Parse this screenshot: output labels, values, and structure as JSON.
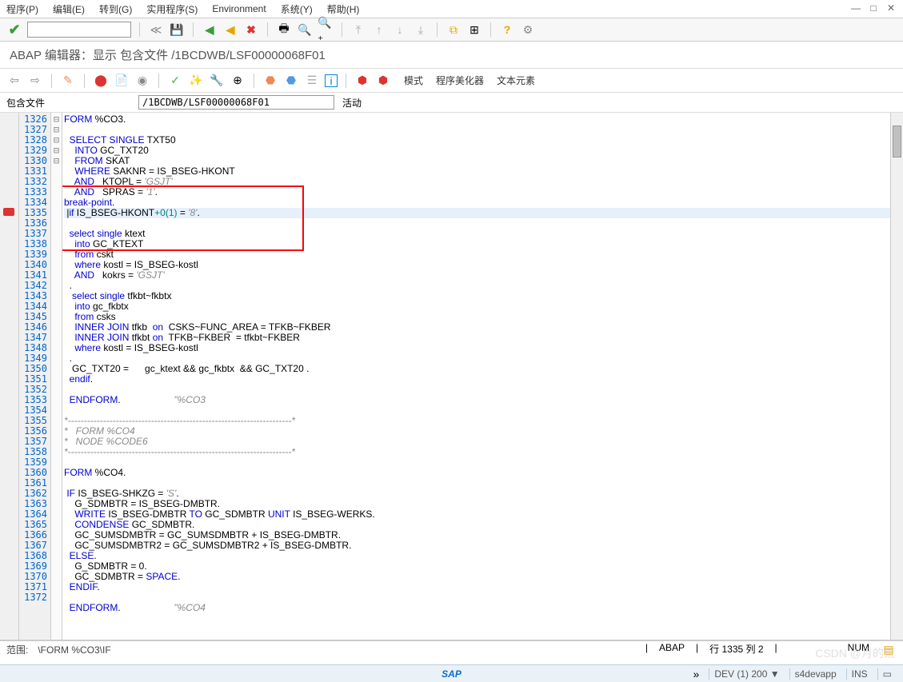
{
  "menu": {
    "program": "程序(P)",
    "edit": "编辑(E)",
    "goto": "转到(G)",
    "utilities": "实用程序(S)",
    "environment": "Environment",
    "system": "系统(Y)",
    "help": "帮助(H)"
  },
  "title": "ABAP 编辑器：显示 包含文件 /1BCDWB/LSF00000068F01",
  "toolbar2_labels": {
    "mode": "模式",
    "beautifier": "程序美化器",
    "text_elem": "文本元素"
  },
  "field": {
    "label": "包含文件",
    "value": "/1BCDWB/LSF00000068F01",
    "after": "活动"
  },
  "lines_start": 1326,
  "lines_end": 1372,
  "current_line": 1335,
  "code_lines": [
    {
      "n": 1326,
      "fold": "⊟",
      "t": "FORM %CO3."
    },
    {
      "n": 1327,
      "t": ""
    },
    {
      "n": 1328,
      "t": "  SELECT SINGLE TXT50"
    },
    {
      "n": 1329,
      "t": "    INTO GC_TXT20"
    },
    {
      "n": 1330,
      "t": "    FROM SKAT"
    },
    {
      "n": 1331,
      "t": "    WHERE SAKNR = IS_BSEG-HKONT"
    },
    {
      "n": 1332,
      "t": "    AND   KTOPL = 'GSJT'"
    },
    {
      "n": 1333,
      "t": "    AND   SPRAS = '1'."
    },
    {
      "n": 1334,
      "t": "break-point."
    },
    {
      "n": 1335,
      "fold": "⊟",
      "t": " |if IS_BSEG-HKONT+0(1) = '8'.",
      "hl": true
    },
    {
      "n": 1336,
      "t": "  select single ktext"
    },
    {
      "n": 1337,
      "t": "    into GC_KTEXT"
    },
    {
      "n": 1338,
      "t": "    from cskt"
    },
    {
      "n": 1339,
      "t": "    where kostl = IS_BSEG-kostl"
    },
    {
      "n": 1340,
      "t": "    AND   kokrs = 'GSJT'"
    },
    {
      "n": 1341,
      "t": "  ."
    },
    {
      "n": 1342,
      "t": "   select single tfkbt~fkbtx"
    },
    {
      "n": 1343,
      "t": "    into gc_fkbtx"
    },
    {
      "n": 1344,
      "t": "    from csks"
    },
    {
      "n": 1345,
      "t": "    INNER JOIN tfkb  on  CSKS~FUNC_AREA = TFKB~FKBER"
    },
    {
      "n": 1346,
      "t": "    INNER JOIN tfkbt on  TFKB~FKBER  = tfkbt~FKBER"
    },
    {
      "n": 1347,
      "t": "    where kostl = IS_BSEG-kostl"
    },
    {
      "n": 1348,
      "t": "  ."
    },
    {
      "n": 1349,
      "t": "   GC_TXT20 =      gc_ktext && gc_fkbtx  && GC_TXT20 ."
    },
    {
      "n": 1350,
      "t": "  endif."
    },
    {
      "n": 1351,
      "t": ""
    },
    {
      "n": 1352,
      "t": "  ENDFORM.                    \"%CO3"
    },
    {
      "n": 1353,
      "t": ""
    },
    {
      "n": 1354,
      "fold": "⊟",
      "t": "*----------------------------------------------------------------------*"
    },
    {
      "n": 1355,
      "t": "*   FORM %CO4"
    },
    {
      "n": 1356,
      "t": "*   NODE %CODE6"
    },
    {
      "n": 1357,
      "t": "*----------------------------------------------------------------------*"
    },
    {
      "n": 1358,
      "t": ""
    },
    {
      "n": 1359,
      "fold": "⊟",
      "t": "FORM %CO4."
    },
    {
      "n": 1360,
      "t": ""
    },
    {
      "n": 1361,
      "fold": "⊟",
      "t": " IF IS_BSEG-SHKZG = 'S'."
    },
    {
      "n": 1362,
      "t": "    G_SDMBTR = IS_BSEG-DMBTR."
    },
    {
      "n": 1363,
      "t": "    WRITE IS_BSEG-DMBTR TO GC_SDMBTR UNIT IS_BSEG-WERKS."
    },
    {
      "n": 1364,
      "t": "    CONDENSE GC_SDMBTR."
    },
    {
      "n": 1365,
      "t": "    GC_SUMSDMBTR = GC_SUMSDMBTR + IS_BSEG-DMBTR."
    },
    {
      "n": 1366,
      "t": "    GC_SUMSDMBTR2 = GC_SUMSDMBTR2 + IS_BSEG-DMBTR."
    },
    {
      "n": 1367,
      "t": "  ELSE."
    },
    {
      "n": 1368,
      "t": "    G_SDMBTR = 0."
    },
    {
      "n": 1369,
      "t": "    GC_SDMBTR = SPACE."
    },
    {
      "n": 1370,
      "t": "  ENDIF."
    },
    {
      "n": 1371,
      "t": ""
    },
    {
      "n": 1372,
      "t": "  ENDFORM.                    \"%CO4"
    }
  ],
  "status": {
    "scope": "范围:",
    "scope_val": "\\FORM %CO3\\IF",
    "lang": "ABAP",
    "pos": "行 1335 列   2",
    "num": "NUM"
  },
  "bottom": {
    "sap": "SAP",
    "dev": "DEV (1) 200",
    "host": "s4devapp",
    "ins": "INS"
  },
  "watermark": "CSDN @月的荒"
}
